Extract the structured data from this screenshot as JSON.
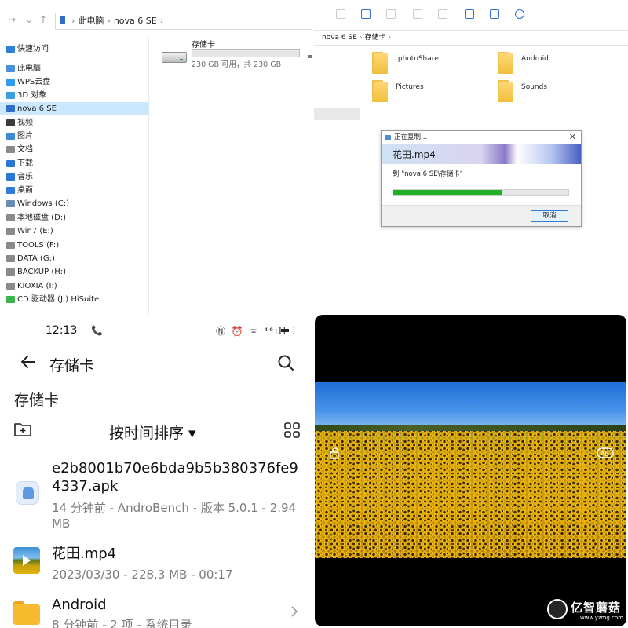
{
  "explorer_pc": {
    "nav_buttons": [
      "→",
      "⌄",
      "↑"
    ],
    "address": [
      "此电脑",
      "nova 6 SE"
    ],
    "nav_items": [
      {
        "label": "快速访问",
        "icon": "star-icon",
        "color": "#2f7fd6"
      },
      {
        "label": "此电脑",
        "icon": "computer-icon",
        "color": "#4a90d9"
      },
      {
        "label": "WPS云盘",
        "icon": "cloud-icon",
        "color": "#2e9cf0"
      },
      {
        "label": "3D 对象",
        "icon": "cube-icon",
        "color": "#3aa0e0"
      },
      {
        "label": "nova 6 SE",
        "icon": "phone-icon",
        "color": "#2f6fc9",
        "selected": true
      },
      {
        "label": "视频",
        "icon": "video-folder-icon",
        "color": "#3b3b3b"
      },
      {
        "label": "图片",
        "icon": "pictures-folder-icon",
        "color": "#3f8ad6"
      },
      {
        "label": "文档",
        "icon": "documents-folder-icon",
        "color": "#8a8a8a"
      },
      {
        "label": "下载",
        "icon": "download-icon",
        "color": "#2b78d4"
      },
      {
        "label": "音乐",
        "icon": "music-icon",
        "color": "#2b78d4"
      },
      {
        "label": "桌面",
        "icon": "desktop-icon",
        "color": "#2e7bd8"
      },
      {
        "label": "Windows (C:)",
        "icon": "windows-drive-icon",
        "color": "#6a8bb5"
      },
      {
        "label": "本地磁盘 (D:)",
        "icon": "drive-icon",
        "color": "#8a8a8a"
      },
      {
        "label": "Win7 (E:)",
        "icon": "drive-icon",
        "color": "#8a8a8a"
      },
      {
        "label": "TOOLS (F:)",
        "icon": "drive-icon",
        "color": "#8a8a8a"
      },
      {
        "label": "DATA (G:)",
        "icon": "drive-icon",
        "color": "#8a8a8a"
      },
      {
        "label": "BACKUP (H:)",
        "icon": "drive-icon",
        "color": "#8a8a8a"
      },
      {
        "label": "KIOXIA (I:)",
        "icon": "drive-icon",
        "color": "#8a8a8a"
      },
      {
        "label": "CD 驱动器 (J:) HiSuite",
        "icon": "hisuite-icon",
        "color": "#39b54a"
      }
    ],
    "drive": {
      "name": "存储卡",
      "free_text": "230 GB 可用，共 230 GB",
      "used_fraction": 0.0
    }
  },
  "explorer_card": {
    "address": [
      "nova 6 SE",
      "存储卡"
    ],
    "folders": [
      ".photoShare",
      "Android",
      "Pictures",
      "Sounds"
    ]
  },
  "copy_dialog": {
    "title": "正在复制...",
    "file": "花田.mp4",
    "dest": "到 \"nova 6 SE\\存储卡\"",
    "progress": 0.62,
    "cancel_label": "取消",
    "close_symbol": "✕"
  },
  "phone": {
    "time": "12:13",
    "call_symbol": "📞",
    "status_icons": "Ⓝ ⏰ ᯤ ⁴⁶ıll",
    "appbar_title": "存储卡",
    "page_heading": "存储卡",
    "sort_label": "按时间排序 ▾",
    "files": [
      {
        "name": "e2b8001b70e6bda9b5b380376fe94337.apk",
        "meta": "14 分钟前 - AndroBench - 版本 5.0.1 - 2.94 MB",
        "icon": "apk-icon"
      },
      {
        "name": "花田.mp4",
        "meta": "2023/03/30 - 228.3 MB - 00:17",
        "icon": "video-thumbnail-icon"
      },
      {
        "name": "Android",
        "meta": "8 分钟前 - 2 项 - 系统目录",
        "icon": "folder-icon"
      }
    ]
  },
  "viewer": {
    "watermark": "亿智蘑菇",
    "watermark_url": "www.yzmg.com"
  }
}
